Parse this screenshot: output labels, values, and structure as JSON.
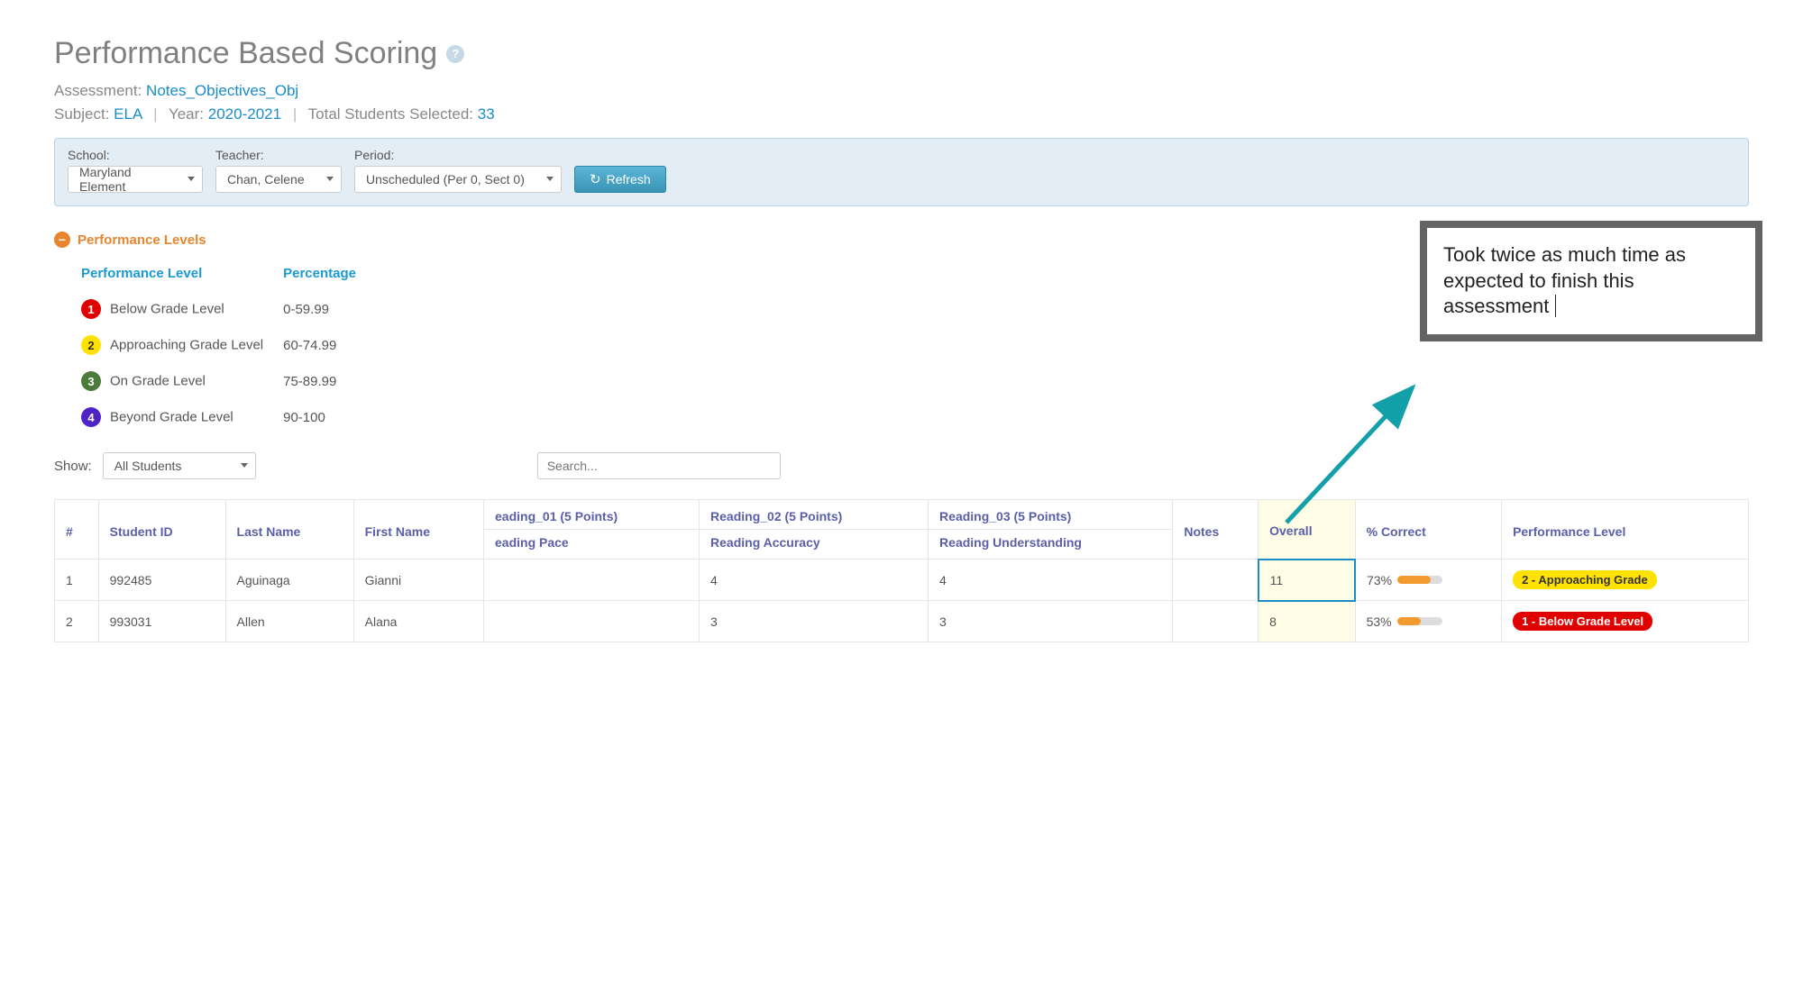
{
  "header": {
    "title": "Performance Based Scoring",
    "assessment_label": "Assessment:",
    "assessment_value": "Notes_Objectives_Obj",
    "subject_label": "Subject:",
    "subject_value": "ELA",
    "year_label": "Year:",
    "year_value": "2020-2021",
    "students_label": "Total Students Selected:",
    "students_value": "33"
  },
  "filters": {
    "school_label": "School:",
    "school_value": "Maryland Element",
    "teacher_label": "Teacher:",
    "teacher_value": "Chan, Celene",
    "period_label": "Period:",
    "period_value": "Unscheduled (Per 0, Sect 0)",
    "refresh_label": "Refresh"
  },
  "levels_section": {
    "title": "Performance Levels",
    "header_level": "Performance Level",
    "header_percentage": "Percentage",
    "rows": [
      {
        "num": "1",
        "name": "Below Grade Level",
        "pct": "0-59.99",
        "css": "level-1"
      },
      {
        "num": "2",
        "name": "Approaching Grade Level",
        "pct": "60-74.99",
        "css": "level-2"
      },
      {
        "num": "3",
        "name": "On Grade Level",
        "pct": "75-89.99",
        "css": "level-3"
      },
      {
        "num": "4",
        "name": "Beyond Grade Level",
        "pct": "90-100",
        "css": "level-4"
      }
    ]
  },
  "show": {
    "label": "Show:",
    "value": "All Students",
    "search_placeholder": "Search..."
  },
  "table": {
    "headers": {
      "num": "#",
      "student_id": "Student ID",
      "last_name": "Last Name",
      "first_name": "First Name",
      "reading_01_top": "eading_01  (5 Points)",
      "reading_01_sub": "eading Pace",
      "reading_02_top": "Reading_02  (5 Points)",
      "reading_02_sub": "Reading Accuracy",
      "reading_03_top": "Reading_03  (5 Points)",
      "reading_03_sub": "Reading Understanding",
      "notes": "Notes",
      "overall": "Overall",
      "pct_correct": "% Correct",
      "perf_level": "Performance Level"
    },
    "rows": [
      {
        "num": "1",
        "id": "992485",
        "last": "Aguinaga",
        "first": "Gianni",
        "r1": "",
        "r2": "4",
        "r3": "4",
        "notes": "",
        "overall": "11",
        "pct": "73%",
        "pct_val": 73,
        "pill": "2 - Approaching Grade",
        "pill_css": "pill-2",
        "active": true
      },
      {
        "num": "2",
        "id": "993031",
        "last": "Allen",
        "first": "Alana",
        "r1": "",
        "r2": "3",
        "r3": "3",
        "notes": "",
        "overall": "8",
        "pct": "53%",
        "pct_val": 53,
        "pill": "1 - Below Grade Level",
        "pill_css": "pill-1",
        "active": false
      }
    ]
  },
  "callout": {
    "text": "Took twice as much time as expected to finish this assessment"
  }
}
